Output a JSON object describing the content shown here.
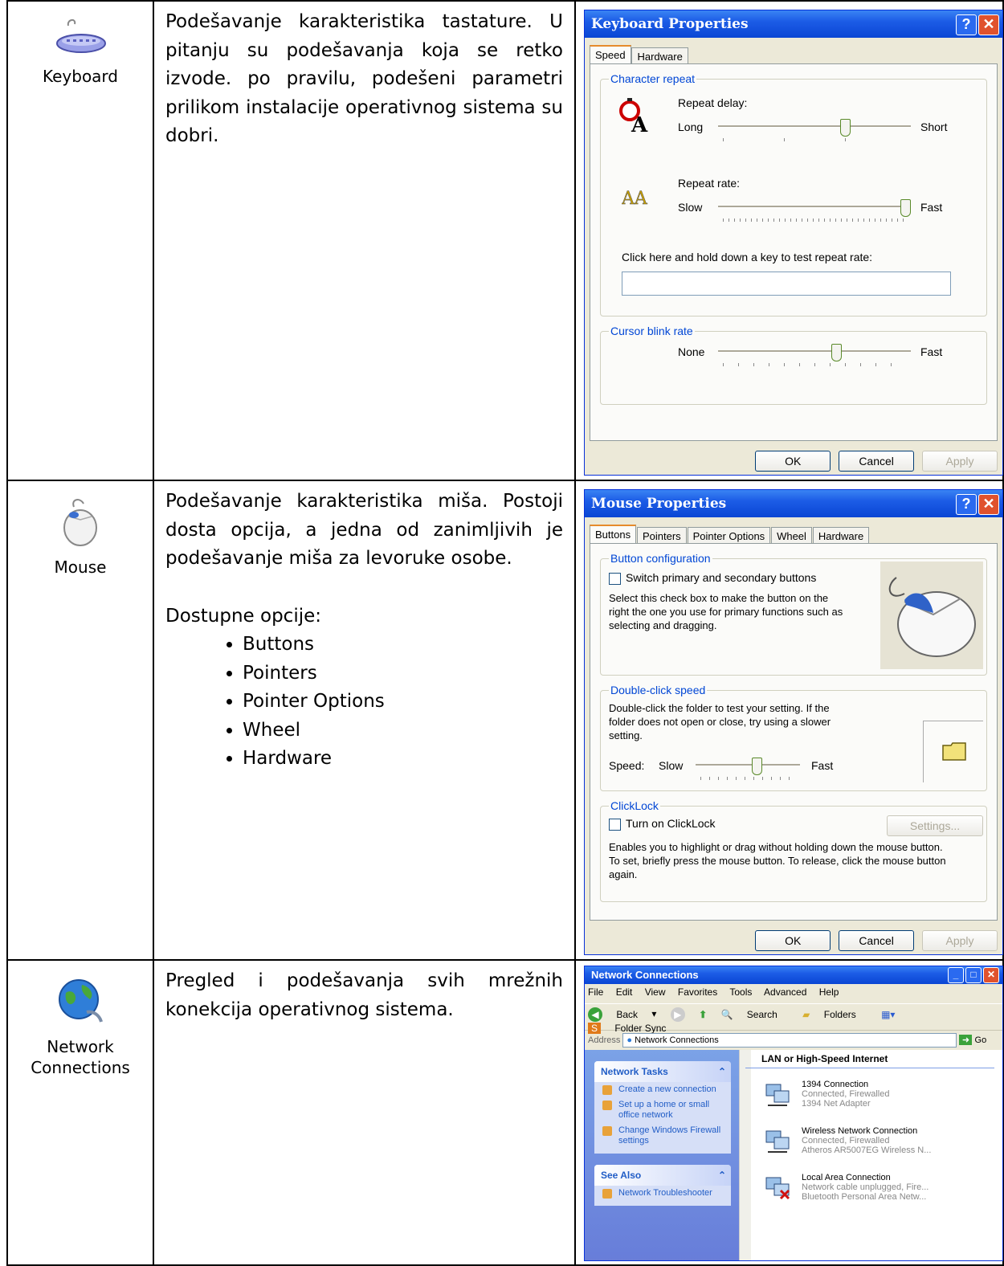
{
  "rows": [
    {
      "icon_label": "Keyboard",
      "description": "Podešavanje karakteristika tastature. U pitanju su podešavanja koja se retko izvode. po pravilu, podešeni parametri prilikom instalacije operativnog sistema su dobri."
    },
    {
      "icon_label": "Mouse",
      "description": "Podešavanje karakteristika miša. Postoji dosta opcija, a jedna od zanimljivih je podešavanje miša za levoruke osobe.",
      "options_title": "Dostupne opcije:",
      "options": [
        "Buttons",
        "Pointers",
        "Pointer Options",
        "Wheel",
        "Hardware"
      ]
    },
    {
      "icon_label_line1": "Network",
      "icon_label_line2": "Connections",
      "description": "Pregled i podešavanja svih mrežnih konekcija operativnog sistema."
    }
  ],
  "keyboard_dialog": {
    "title": "Keyboard Properties",
    "tabs": [
      "Speed",
      "Hardware"
    ],
    "char_repeat_legend": "Character repeat",
    "repeat_delay_label": "Repeat delay:",
    "long": "Long",
    "short": "Short",
    "repeat_delay_value": 0.67,
    "repeat_rate_label": "Repeat rate:",
    "slow": "Slow",
    "fast": "Fast",
    "repeat_rate_value": 1.0,
    "test_label": "Click here and hold down a key to test repeat rate:",
    "test_value": "",
    "cursor_legend": "Cursor blink rate",
    "none": "None",
    "cursor_value": 0.62,
    "ok": "OK",
    "cancel": "Cancel",
    "apply": "Apply"
  },
  "mouse_dialog": {
    "title": "Mouse Properties",
    "tabs": [
      "Buttons",
      "Pointers",
      "Pointer Options",
      "Wheel",
      "Hardware"
    ],
    "button_config_legend": "Button configuration",
    "switch_label": "Switch primary and secondary buttons",
    "switch_help": "Select this check box to make the button on the right the one you use for primary functions such as selecting and dragging.",
    "dbl_legend": "Double-click speed",
    "dbl_help": "Double-click the folder to test your setting. If the folder does not open or close, try using a slower setting.",
    "speed_label": "Speed:",
    "slow": "Slow",
    "fast": "Fast",
    "speed_value": 0.6,
    "clicklock_legend": "ClickLock",
    "clicklock_label": "Turn on ClickLock",
    "settings": "Settings...",
    "clicklock_help": "Enables you to highlight or drag without holding down the mouse button. To set, briefly press the mouse button. To release, click the mouse button again.",
    "ok": "OK",
    "cancel": "Cancel",
    "apply": "Apply"
  },
  "network_window": {
    "title": "Network Connections",
    "menu": [
      "File",
      "Edit",
      "View",
      "Favorites",
      "Tools",
      "Advanced",
      "Help"
    ],
    "toolbar": [
      "Back",
      "Search",
      "Folders",
      "Folder Sync"
    ],
    "address_label": "Address",
    "address_value": "Network Connections",
    "go": "Go",
    "tasks_header": "Network Tasks",
    "tasks": [
      "Create a new connection",
      "Set up a home or small office network",
      "Change Windows Firewall settings"
    ],
    "see_also_header": "See Also",
    "see_also": [
      "Network Troubleshooter"
    ],
    "group_header": "LAN or High-Speed Internet",
    "connections": [
      {
        "name": "1394 Connection",
        "status": "Connected, Firewalled",
        "device": "1394 Net Adapter"
      },
      {
        "name": "Wireless Network Connection",
        "status": "Connected, Firewalled",
        "device": "Atheros AR5007EG Wireless N..."
      },
      {
        "name": "Local Area Connection",
        "status": "Network cable unplugged, Fire...",
        "device": "Bluetooth Personal Area Netw..."
      }
    ]
  }
}
